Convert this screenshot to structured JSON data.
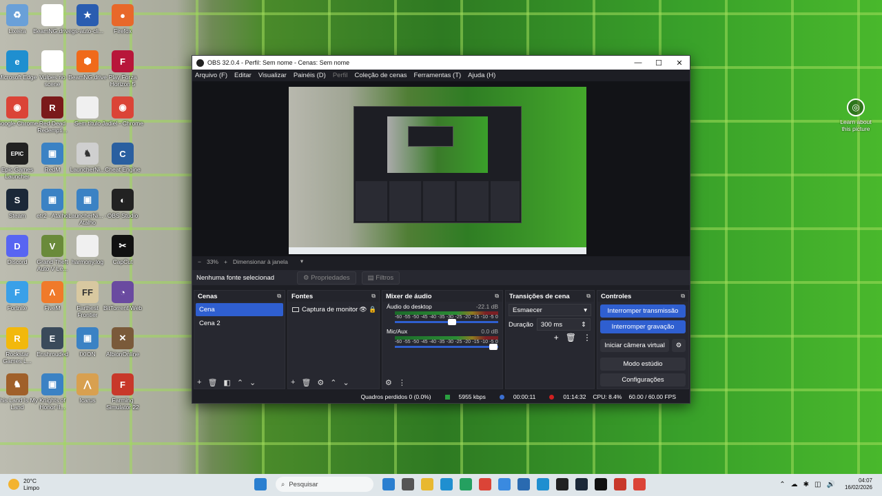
{
  "desktop_icons": [
    {
      "label": "Lixeira",
      "icon": "recycle-bin-icon",
      "color": "#6aa0d8",
      "glyph": "♻"
    },
    {
      "label": "BeamNG.drive",
      "icon": "file-icon",
      "color": "#ffffff",
      "glyph": ""
    },
    {
      "label": "gs-auto-cli...",
      "icon": "star-icon",
      "color": "#2a5db0",
      "glyph": "★"
    },
    {
      "label": "Firefox",
      "icon": "firefox-icon",
      "color": "#e8682a",
      "glyph": "●"
    },
    {
      "label": "Microsoft Edge",
      "icon": "edge-icon",
      "color": "#1f8fd0",
      "glyph": "e"
    },
    {
      "label": "Vulpes no scene",
      "icon": "file-icon",
      "color": "#ffffff",
      "glyph": ""
    },
    {
      "label": "BeamNG.drive",
      "icon": "beamng-icon",
      "color": "#f06a1a",
      "glyph": "⬢"
    },
    {
      "label": "Play Forza Horizon 5",
      "icon": "forza-icon",
      "color": "#b8163a",
      "glyph": "F"
    },
    {
      "label": "Google Chrome",
      "icon": "chrome-icon",
      "color": "#db4437",
      "glyph": "◉"
    },
    {
      "label": "Red Dead Redempti...",
      "icon": "rdr-icon",
      "color": "#7a1a1a",
      "glyph": "R"
    },
    {
      "label": "Sem título",
      "icon": "file-icon",
      "color": "#f0f0f0",
      "glyph": ""
    },
    {
      "label": "Jadiel - Chrome",
      "icon": "chrome-icon",
      "color": "#db4437",
      "glyph": "◉"
    },
    {
      "label": "Epic Games Launcher",
      "icon": "epic-icon",
      "color": "#222222",
      "glyph": "EPIC"
    },
    {
      "label": "RedM",
      "icon": "shortcut-icon",
      "color": "#3b82c4",
      "glyph": "▣"
    },
    {
      "label": "LauncherNi...",
      "icon": "unicorn-icon",
      "color": "#cfcfcf",
      "glyph": "♞"
    },
    {
      "label": "Cheat Engine",
      "icon": "cheat-engine-icon",
      "color": "#2a5fa0",
      "glyph": "C"
    },
    {
      "label": "Steam",
      "icon": "steam-icon",
      "color": "#1b2838",
      "glyph": "S"
    },
    {
      "label": "etr2 - Atalho",
      "icon": "shortcut-icon",
      "color": "#3b82c4",
      "glyph": "▣"
    },
    {
      "label": "LauncherNi... - Atalho",
      "icon": "shortcut-icon",
      "color": "#3b82c4",
      "glyph": "▣"
    },
    {
      "label": "OBS Studio",
      "icon": "obs-icon",
      "color": "#222222",
      "glyph": "◐"
    },
    {
      "label": "Discord",
      "icon": "discord-icon",
      "color": "#5865f2",
      "glyph": "D"
    },
    {
      "label": "Grand Theft Auto V Le...",
      "icon": "gta-icon",
      "color": "#6a8a3a",
      "glyph": "V"
    },
    {
      "label": "harmony.log",
      "icon": "file-icon",
      "color": "#f0f0f0",
      "glyph": ""
    },
    {
      "label": "CapCut",
      "icon": "capcut-icon",
      "color": "#111111",
      "glyph": "✂"
    },
    {
      "label": "Fortnite",
      "icon": "fortnite-icon",
      "color": "#3aa0e8",
      "glyph": "F"
    },
    {
      "label": "FiveM",
      "icon": "fivem-icon",
      "color": "#f07a2a",
      "glyph": "Λ"
    },
    {
      "label": "Farthest Frontier",
      "icon": "ff-icon",
      "color": "#d8c8a0",
      "glyph": "FF"
    },
    {
      "label": "BitTorrent Web",
      "icon": "bittorrent-icon",
      "color": "#6a4aa0",
      "glyph": "◔"
    },
    {
      "label": "Rockstar Games L...",
      "icon": "rockstar-icon",
      "color": "#f2b80c",
      "glyph": "R"
    },
    {
      "label": "Enshrouded",
      "icon": "enshrouded-icon",
      "color": "#3a4a5a",
      "glyph": "E"
    },
    {
      "label": "IXION",
      "icon": "shortcut-icon",
      "color": "#3b82c4",
      "glyph": "▣"
    },
    {
      "label": "AlbionOnline",
      "icon": "albion-icon",
      "color": "#7a5a3a",
      "glyph": "✕"
    },
    {
      "label": "This Land Is My Land",
      "icon": "horse-icon",
      "color": "#a0602a",
      "glyph": "♞"
    },
    {
      "label": "Knights of Honor II...",
      "icon": "shortcut-icon",
      "color": "#3b82c4",
      "glyph": "▣"
    },
    {
      "label": "Icarus",
      "icon": "icarus-icon",
      "color": "#d8a050",
      "glyph": "⋀"
    },
    {
      "label": "Farming Simulator 22",
      "icon": "farming-icon",
      "color": "#c8382a",
      "glyph": "F"
    }
  ],
  "learn": {
    "label": "Learn about this picture"
  },
  "window": {
    "title": "OBS 32.0.4 - Perfil: Sem nome - Cenas: Sem nome",
    "menu": [
      "Arquivo (F)",
      "Editar",
      "Visualizar",
      "Painéis (D)",
      "Perfil",
      "Coleção de cenas",
      "Ferramentas (T)",
      "Ajuda (H)"
    ],
    "zoom": "33%",
    "zoom_mode": "Dimensionar à janela",
    "no_source": "Nenhuma fonte selecionad",
    "properties": "Propriedades",
    "filters": "Filtros"
  },
  "scenes": {
    "title": "Cenas",
    "items": [
      "Cena",
      "Cena 2"
    ]
  },
  "sources": {
    "title": "Fontes",
    "items": [
      "Captura de monitor"
    ]
  },
  "mixer": {
    "title": "Mixer de áudio",
    "scale": [
      "-60",
      "-55",
      "-50",
      "-45",
      "-40",
      "-35",
      "-30",
      "-25",
      "-20",
      "-15",
      "-10",
      "-5",
      "0"
    ],
    "channels": [
      {
        "name": "Áudio do desktop",
        "db": "-22.1 dB",
        "level": 0.55
      },
      {
        "name": "Mic/Aux",
        "db": "0.0 dB",
        "level": 0.95
      }
    ]
  },
  "transitions": {
    "title": "Transições de cena",
    "selected": "Esmaecer",
    "duration_label": "Duração",
    "duration": "300 ms"
  },
  "controls": {
    "title": "Controles",
    "stop_stream": "Interromper transmissão",
    "stop_record": "Interromper gravação",
    "virtual_cam": "Iniciar câmera virtual",
    "studio": "Modo estúdio",
    "settings": "Configurações"
  },
  "status": {
    "dropped": "Quadros perdidos 0 (0.0%)",
    "bitrate": "5955 kbps",
    "stream_time": "00:00:11",
    "rec_time": "01:14:32",
    "cpu": "CPU: 8.4%",
    "fps": "60.00 / 60.00 FPS"
  },
  "taskbar": {
    "temp": "20°C",
    "weather": "Limpo",
    "search": "Pesquisar",
    "time": "04:07",
    "date": "16/02/2026",
    "apps": [
      "#2a7fd0",
      "#555",
      "#e8b830",
      "#1f8fd0",
      "#25a060",
      "#db4437",
      "#3a8ae0",
      "#2a6ab0",
      "#1f8fd0",
      "#222",
      "#1b2838",
      "#111",
      "#c8382a",
      "#db4437"
    ]
  }
}
